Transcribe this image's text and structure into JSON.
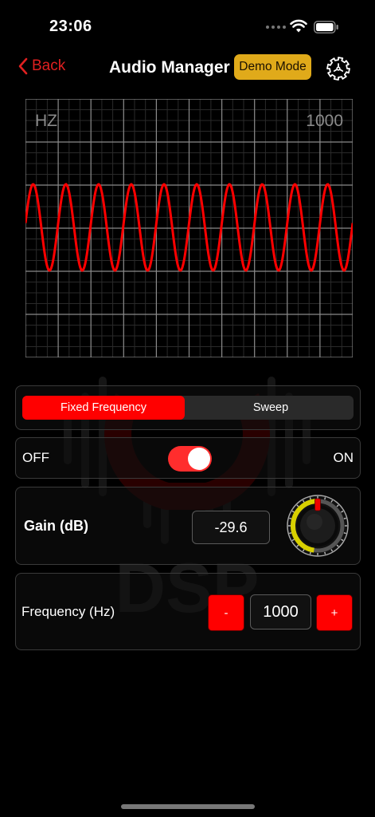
{
  "status": {
    "time": "23:06"
  },
  "nav": {
    "back_label": "Back",
    "title": "Audio Manager",
    "badge": "Demo Mode"
  },
  "scope": {
    "label_left": "HZ",
    "label_right": "1000",
    "trace_color": "#ff0000",
    "cycles_visible": 10
  },
  "watermark": {
    "text": "DSP"
  },
  "mode": {
    "options": [
      "Fixed Frequency",
      "Sweep"
    ],
    "selected": "Fixed Frequency"
  },
  "output": {
    "off_label": "OFF",
    "on_label": "ON",
    "state": "on"
  },
  "gain": {
    "label": "Gain (dB)",
    "value": "-29.6"
  },
  "frequency": {
    "label": "Frequency (Hz)",
    "minus_label": "-",
    "plus_label": "+",
    "value": "1000"
  },
  "colors": {
    "accent": "#ff0000",
    "badge": "#e0aa1a",
    "knob_ring": "#d8d000",
    "back": "#e02020"
  },
  "icons": [
    "chevron-left-icon",
    "gear-icon",
    "wifi-icon",
    "battery-icon"
  ]
}
